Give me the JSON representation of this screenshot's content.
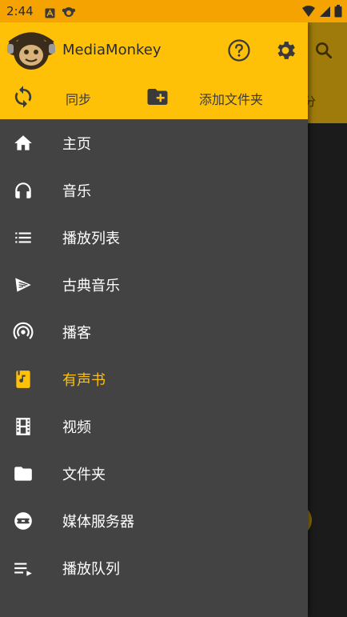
{
  "status_bar": {
    "time": "2:44"
  },
  "drawer": {
    "app_title": "MediaMonkey",
    "actions": {
      "sync_label": "同步",
      "add_folder_label": "添加文件夹"
    },
    "menu": [
      {
        "label": "主页",
        "icon": "home-icon"
      },
      {
        "label": "音乐",
        "icon": "headphones-icon"
      },
      {
        "label": "播放列表",
        "icon": "playlist-icon"
      },
      {
        "label": "古典音乐",
        "icon": "classical-icon"
      },
      {
        "label": "播客",
        "icon": "podcast-icon"
      },
      {
        "label": "有声书",
        "icon": "audiobook-icon",
        "active": true
      },
      {
        "label": "视频",
        "icon": "video-icon"
      },
      {
        "label": "文件夹",
        "icon": "folder-icon"
      },
      {
        "label": "媒体服务器",
        "icon": "media-server-icon"
      },
      {
        "label": "播放队列",
        "icon": "queue-icon"
      }
    ]
  },
  "background": {
    "tab_fragment": "分"
  },
  "colors": {
    "accent": "#ffc107",
    "drawer_bg": "#434343",
    "status_bar": "#f4a300"
  }
}
